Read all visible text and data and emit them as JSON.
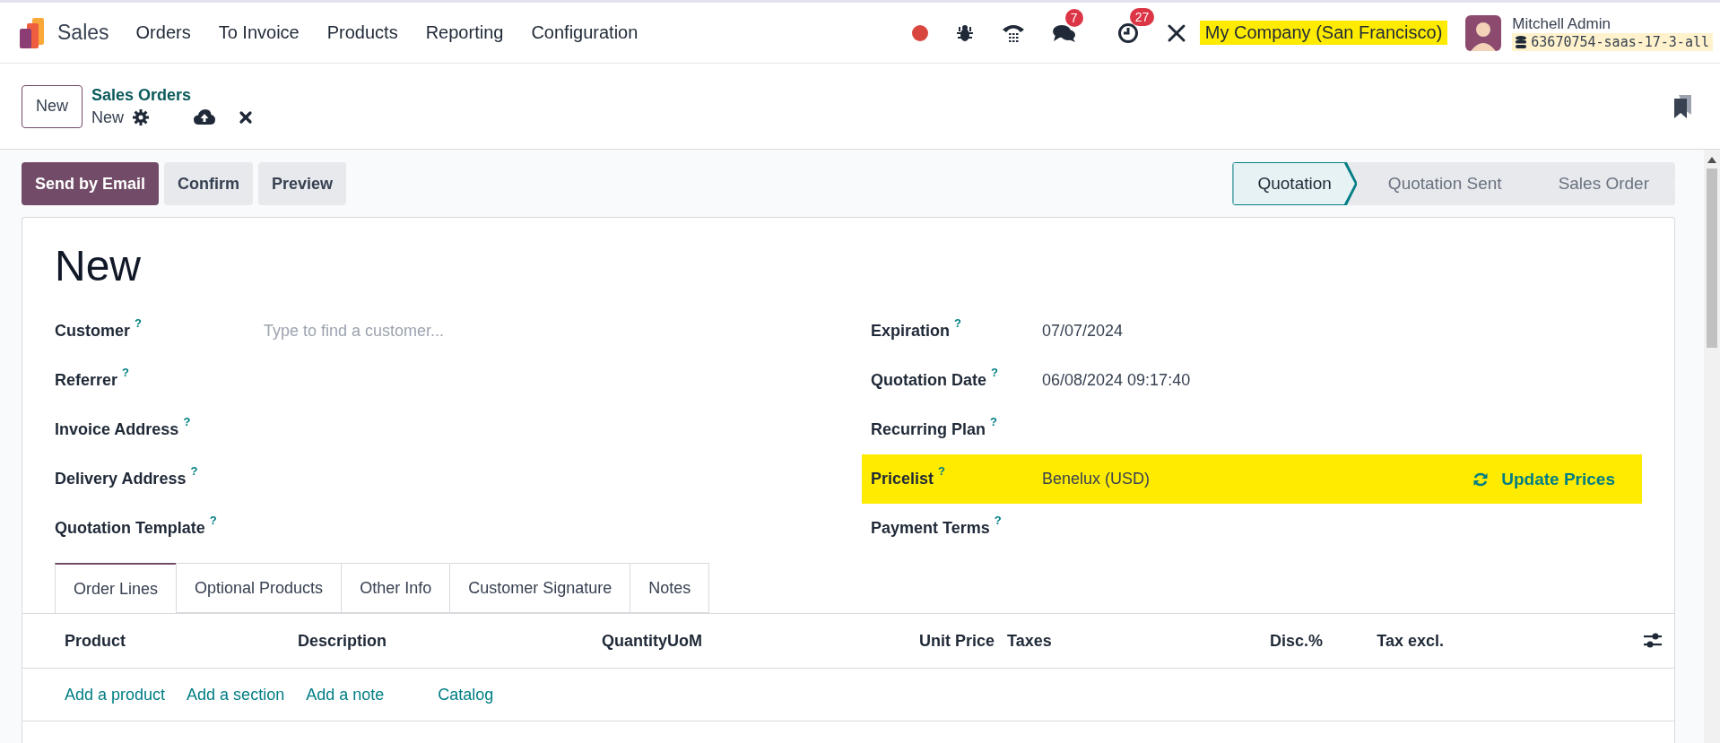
{
  "navbar": {
    "app_name": "Sales",
    "menu": [
      "Orders",
      "To Invoice",
      "Products",
      "Reporting",
      "Configuration"
    ],
    "messages_badge": "7",
    "activities_badge": "27",
    "company": {
      "label": "My Company (San Francisco)",
      "highlighted": true
    },
    "user": {
      "name": "Mitchell Admin",
      "database": "63670754-saas-17-3-all"
    }
  },
  "breadcrumb": {
    "new_button": "New",
    "parent": "Sales Orders",
    "current": "New"
  },
  "actions": [
    {
      "label": "Send by Email",
      "kind": "primary"
    },
    {
      "label": "Confirm",
      "kind": "secondary"
    },
    {
      "label": "Preview",
      "kind": "secondary"
    }
  ],
  "status_bar": [
    {
      "label": "Quotation",
      "selected": true
    },
    {
      "label": "Quotation Sent",
      "selected": false
    },
    {
      "label": "Sales Order",
      "selected": false
    }
  ],
  "form": {
    "title": "New",
    "left_fields": [
      {
        "label": "Customer",
        "help": "?",
        "placeholder": "Type to find a customer..."
      },
      {
        "label": "Referrer",
        "help": "?"
      },
      {
        "label": "Invoice Address",
        "help": "?"
      },
      {
        "label": "Delivery Address",
        "help": "?"
      },
      {
        "label": "Quotation Template",
        "help": "?"
      }
    ],
    "right_fields": [
      {
        "label": "Expiration",
        "help": "?",
        "value": "07/07/2024"
      },
      {
        "label": "Quotation Date",
        "help": "?",
        "value": "06/08/2024 09:17:40"
      },
      {
        "label": "Recurring Plan",
        "help": "?"
      },
      {
        "label": "Pricelist",
        "help": "?",
        "value": "Benelux (USD)",
        "highlighted": true,
        "action": "Update Prices"
      },
      {
        "label": "Payment Terms",
        "help": "?"
      }
    ],
    "tabs": [
      {
        "label": "Order Lines",
        "selected": true
      },
      {
        "label": "Optional Products",
        "selected": false
      },
      {
        "label": "Other Info",
        "selected": false
      },
      {
        "label": "Customer Signature",
        "selected": false
      },
      {
        "label": "Notes",
        "selected": false
      }
    ],
    "columns": [
      "Product",
      "Description",
      "Quantity",
      "UoM",
      "Unit Price",
      "Taxes",
      "Disc.%",
      "Tax excl."
    ],
    "add_links": [
      "Add a product",
      "Add a section",
      "Add a note",
      "Catalog"
    ]
  }
}
